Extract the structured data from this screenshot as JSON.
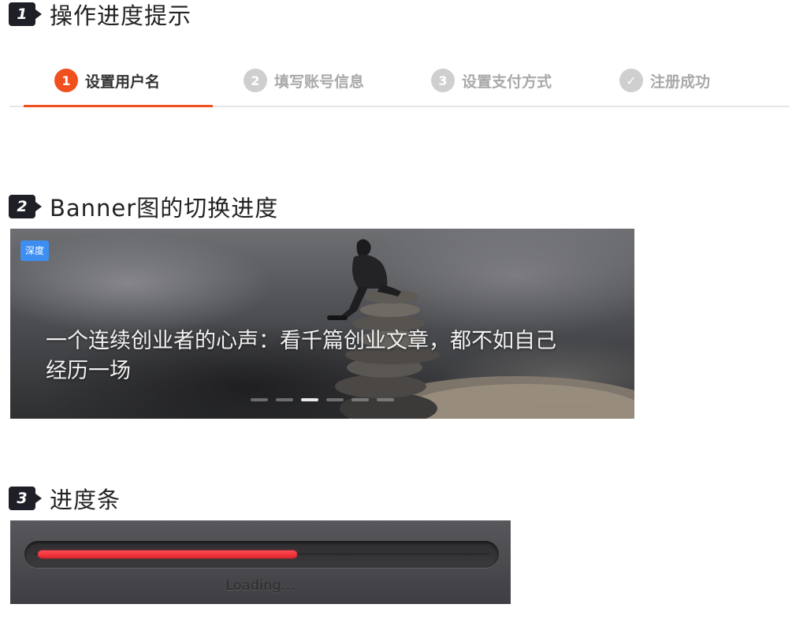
{
  "section1": {
    "number": "1",
    "title": "操作进度提示",
    "steps": [
      {
        "index": "1",
        "label": "设置用户名",
        "state": "active"
      },
      {
        "index": "2",
        "label": "填写账号信息",
        "state": "inactive"
      },
      {
        "index": "3",
        "label": "设置支付方式",
        "state": "inactive"
      },
      {
        "index": "✓",
        "label": "注册成功",
        "state": "inactive"
      }
    ],
    "active_color": "#f0501e",
    "inactive_color": "#cfcfcf"
  },
  "section2": {
    "number": "2",
    "title": "Banner图的切换进度",
    "banner": {
      "tag": "深度",
      "title": "一个连续创业者的心声：看千篇创业文章，都不如自己经历一场",
      "slide_count": 6,
      "active_slide": 3
    }
  },
  "section3": {
    "number": "3",
    "title": "进度条",
    "progress": {
      "label": "Loading...",
      "fraction": 0.58,
      "fill_color": "#e0232c"
    }
  }
}
